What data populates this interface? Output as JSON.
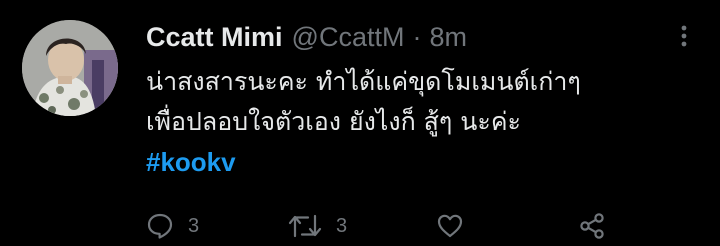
{
  "tweet": {
    "display_name": "Ccatt Mimi",
    "handle": "@CcattM",
    "separator": "·",
    "time": "8m",
    "lines": [
      "น่าสงสารนะคะ ทำได้แค่ขุดโมเมนต์เก่าๆ",
      "เพื่อปลอบใจตัวเอง ยังไงก็ สู้ๆ นะค่ะ"
    ],
    "hashtag": "#kookv"
  },
  "actions": {
    "reply_count": "3",
    "retweet_count": "3"
  },
  "icons": {
    "more": "more-icon",
    "reply": "reply-icon",
    "retweet": "retweet-icon",
    "like": "like-icon",
    "share": "share-icon"
  },
  "colors": {
    "background": "#000000",
    "text": "#e7e9ea",
    "secondary": "#71767b",
    "link": "#1d9bf0"
  }
}
